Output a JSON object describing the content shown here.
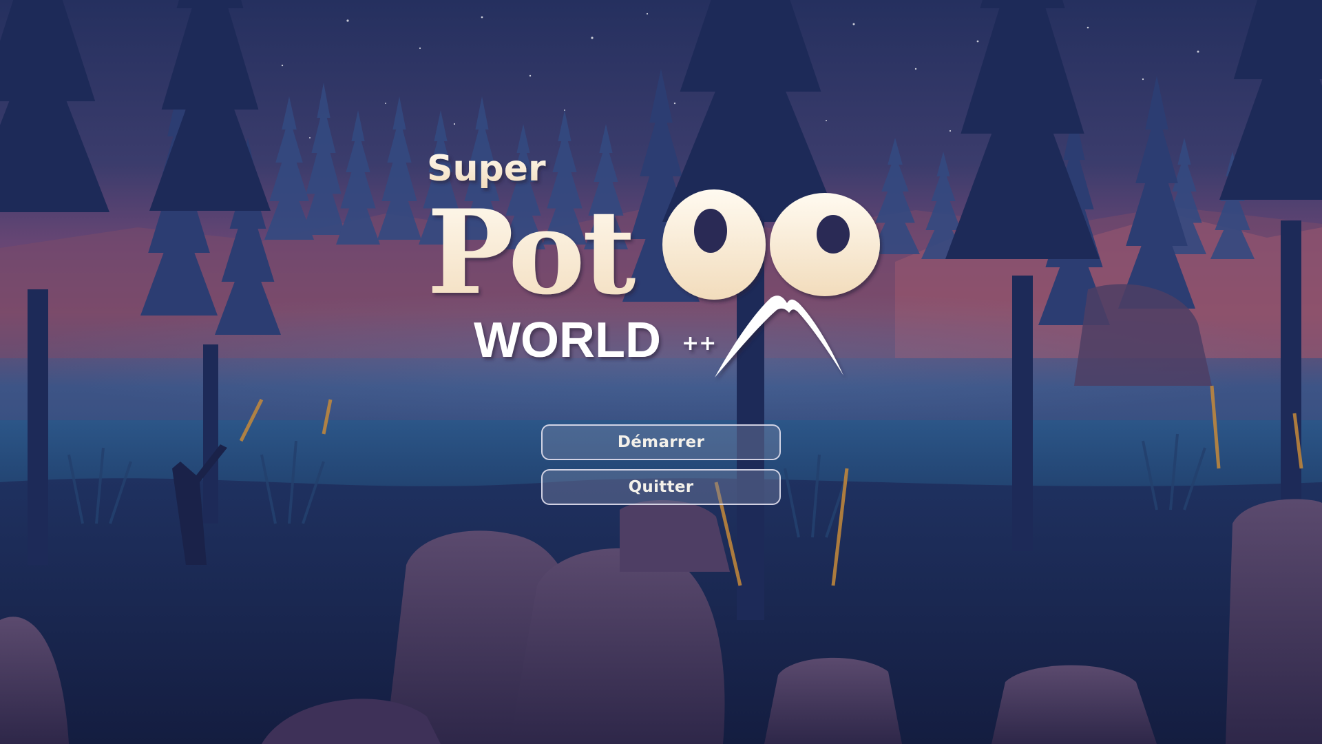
{
  "logo": {
    "super": "Super",
    "pot": "Pot",
    "oo": "OO",
    "world": "WORLD",
    "plusplus": "++"
  },
  "menu": {
    "start_label": "Démarrer",
    "quit_label": "Quitter"
  },
  "colors": {
    "sky_top": "#2a3567",
    "sky_mid": "#5a4470",
    "sky_glow": "#8a4a68",
    "forest_far": "#3a4f85",
    "forest_mid": "#2d3f74",
    "forest_near": "#1f2c5a",
    "rock": "#4a3a5e",
    "logo_cream": "#fbf0dc",
    "logo_white": "#ffffff",
    "grass_gold": "#c58a3a"
  }
}
